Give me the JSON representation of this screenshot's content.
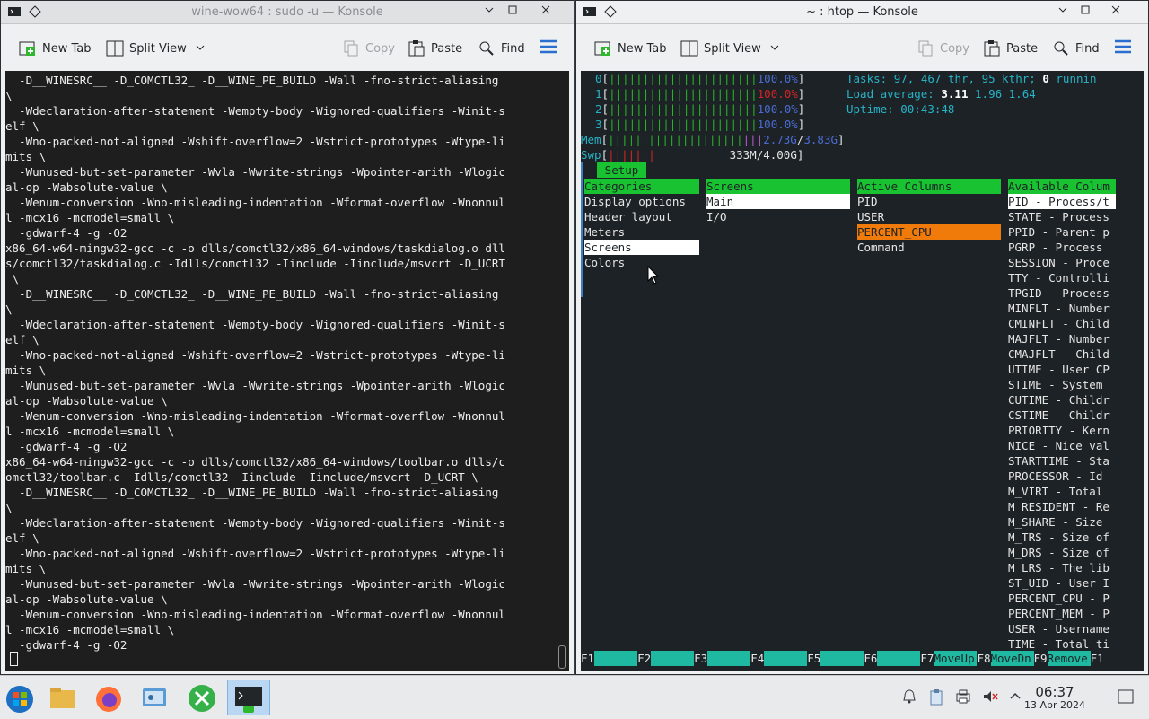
{
  "left_window": {
    "title": "wine-wow64 : sudo -u — Konsole",
    "toolbar": {
      "new_tab": "New Tab",
      "split_view": "Split View",
      "copy": "Copy",
      "paste": "Paste",
      "find": "Find"
    },
    "terminal_lines": [
      "  -D__WINESRC__ -D_COMCTL32_ -D__WINE_PE_BUILD -Wall -fno-strict-aliasing",
      "\\",
      "  -Wdeclaration-after-statement -Wempty-body -Wignored-qualifiers -Winit-s",
      "elf \\",
      "  -Wno-packed-not-aligned -Wshift-overflow=2 -Wstrict-prototypes -Wtype-li",
      "mits \\",
      "  -Wunused-but-set-parameter -Wvla -Wwrite-strings -Wpointer-arith -Wlogic",
      "al-op -Wabsolute-value \\",
      "  -Wenum-conversion -Wno-misleading-indentation -Wformat-overflow -Wnonnul",
      "l -mcx16 -mcmodel=small \\",
      "  -gdwarf-4 -g -O2",
      "x86_64-w64-mingw32-gcc -c -o dlls/comctl32/x86_64-windows/taskdialog.o dll",
      "s/comctl32/taskdialog.c -Idlls/comctl32 -Iinclude -Iinclude/msvcrt -D_UCRT",
      " \\",
      "  -D__WINESRC__ -D_COMCTL32_ -D__WINE_PE_BUILD -Wall -fno-strict-aliasing",
      "\\",
      "  -Wdeclaration-after-statement -Wempty-body -Wignored-qualifiers -Winit-s",
      "elf \\",
      "  -Wno-packed-not-aligned -Wshift-overflow=2 -Wstrict-prototypes -Wtype-li",
      "mits \\",
      "  -Wunused-but-set-parameter -Wvla -Wwrite-strings -Wpointer-arith -Wlogic",
      "al-op -Wabsolute-value \\",
      "  -Wenum-conversion -Wno-misleading-indentation -Wformat-overflow -Wnonnul",
      "l -mcx16 -mcmodel=small \\",
      "  -gdwarf-4 -g -O2",
      "x86_64-w64-mingw32-gcc -c -o dlls/comctl32/x86_64-windows/toolbar.o dlls/c",
      "omctl32/toolbar.c -Idlls/comctl32 -Iinclude -Iinclude/msvcrt -D_UCRT \\",
      "  -D__WINESRC__ -D_COMCTL32_ -D__WINE_PE_BUILD -Wall -fno-strict-aliasing",
      "\\",
      "  -Wdeclaration-after-statement -Wempty-body -Wignored-qualifiers -Winit-s",
      "elf \\",
      "  -Wno-packed-not-aligned -Wshift-overflow=2 -Wstrict-prototypes -Wtype-li",
      "mits \\",
      "  -Wunused-but-set-parameter -Wvla -Wwrite-strings -Wpointer-arith -Wlogic",
      "al-op -Wabsolute-value \\",
      "  -Wenum-conversion -Wno-misleading-indentation -Wformat-overflow -Wnonnul",
      "l -mcx16 -mcmodel=small \\",
      "  -gdwarf-4 -g -O2"
    ]
  },
  "right_window": {
    "title": "~ : htop — Konsole",
    "toolbar": {
      "new_tab": "New Tab",
      "split_view": "Split View",
      "copy": "Copy",
      "paste": "Paste",
      "find": "Find"
    },
    "htop": {
      "cpus": [
        {
          "id": "0",
          "bar": "||||||||||||||||||||||",
          "pct": "100.0%"
        },
        {
          "id": "1",
          "bar": "||||||||||||||||||||||",
          "pct": "100.0%"
        },
        {
          "id": "2",
          "bar": "||||||||||||||||||||||",
          "pct": "100.0%"
        },
        {
          "id": "3",
          "bar": "||||||||||||||||||||||",
          "pct": "100.0%"
        }
      ],
      "mem_label": "Mem",
      "mem_bar": "||||||||||||||||||||",
      "mem_used": "2.73G",
      "mem_total": "3.83G",
      "swp_label": "Swp",
      "swp_bar": "|||||||",
      "swp_value": "333M/4.00G",
      "tasks_label": "Tasks:",
      "tasks_procs": "97",
      "tasks_thr": "467",
      "tasks_thr_label": "thr,",
      "tasks_kthr": "95",
      "tasks_kthr_label": "kthr;",
      "tasks_running": "0",
      "tasks_running_label": "runnin",
      "load_label": "Load average:",
      "load_1": "3.11",
      "load_5": "1.96",
      "load_15": "1.64",
      "uptime_label": "Uptime:",
      "uptime": "00:43:48",
      "setup_tab": "Setup",
      "categories_header": "Categories",
      "categories": [
        "Display options",
        "Header layout",
        "Meters",
        "Screens",
        "Colors"
      ],
      "screens_header": "Screens",
      "screens": [
        "Main",
        "I/O"
      ],
      "active_header": "Active Columns",
      "active_columns": [
        "PID",
        "USER",
        "PERCENT_CPU",
        "Command"
      ],
      "available_header": "Available Colum",
      "available_columns": [
        "PID - Process/t",
        "STATE - Process",
        "PPID - Parent p",
        "PGRP - Process",
        "SESSION - Proce",
        "TTY - Controlli",
        "TPGID - Process",
        "MINFLT - Number",
        "CMINFLT - Child",
        "MAJFLT - Number",
        "CMAJFLT - Child",
        "UTIME - User CP",
        "STIME - System",
        "CUTIME - Childr",
        "CSTIME - Childr",
        "PRIORITY - Kern",
        "NICE - Nice val",
        "STARTTIME - Sta",
        "PROCESSOR - Id",
        "M_VIRT - Total",
        "M_RESIDENT - Re",
        "M_SHARE - Size",
        "M_TRS - Size of",
        "M_DRS - Size of",
        "M_LRS - The lib",
        "ST_UID - User I",
        "PERCENT_CPU - P",
        "PERCENT_MEM - P",
        "USER - Username",
        "TIME - Total ti"
      ],
      "fkeys": [
        {
          "key": "F1",
          "label": ""
        },
        {
          "key": "F2",
          "label": ""
        },
        {
          "key": "F3",
          "label": ""
        },
        {
          "key": "F4",
          "label": ""
        },
        {
          "key": "F5",
          "label": ""
        },
        {
          "key": "F6",
          "label": ""
        },
        {
          "key": "F7",
          "label": "MoveUp"
        },
        {
          "key": "F8",
          "label": "MoveDn"
        },
        {
          "key": "F9",
          "label": "Remove"
        },
        {
          "key": "F1",
          "label": ""
        }
      ]
    }
  },
  "taskbar": {
    "apps": [
      "start-menu-icon",
      "file-manager-icon",
      "firefox-icon",
      "system-settings-icon",
      "wine-icon",
      "konsole-icon"
    ],
    "time": "06:37",
    "date": "13 Apr 2024"
  }
}
